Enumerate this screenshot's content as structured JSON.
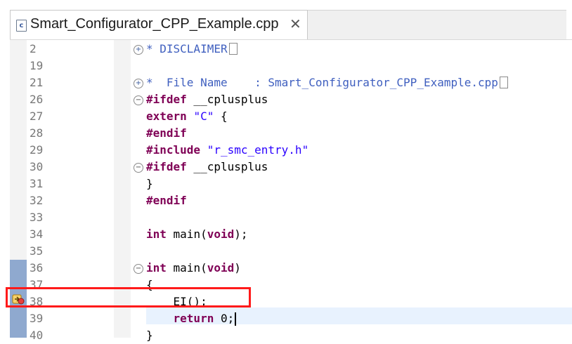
{
  "editor_tab": {
    "title": "Smart_Configurator_CPP_Example.cpp",
    "icon": "cpp-file-icon",
    "close_icon": "close-icon"
  },
  "colors": {
    "keyword": "#7f0055",
    "string": "#2a00ff",
    "comment": "#3f5fbf",
    "current_line": "#e8f2fe",
    "annotation_box": "#ff1a1a"
  },
  "code_lines": [
    {
      "number": "2",
      "fold": "expand",
      "collapsed": true,
      "tokens": [
        {
          "t": "* DISCLAIMER",
          "c": "cmt"
        }
      ]
    },
    {
      "number": "19",
      "fold": "",
      "collapsed": false,
      "tokens": []
    },
    {
      "number": "21",
      "fold": "expand",
      "collapsed": true,
      "tokens": [
        {
          "t": "*  File Name    : Smart_Configurator_CPP_Example.cpp",
          "c": "cmt"
        }
      ]
    },
    {
      "number": "26",
      "fold": "collapse",
      "collapsed": false,
      "tokens": [
        {
          "t": "#ifdef",
          "c": "kw"
        },
        {
          "t": " __cplusplus",
          "c": "plain"
        }
      ]
    },
    {
      "number": "27",
      "fold": "",
      "collapsed": false,
      "tokens": [
        {
          "t": "extern",
          "c": "kw"
        },
        {
          "t": " ",
          "c": "plain"
        },
        {
          "t": "\"C\"",
          "c": "str"
        },
        {
          "t": " {",
          "c": "plain"
        }
      ]
    },
    {
      "number": "28",
      "fold": "",
      "collapsed": false,
      "tokens": [
        {
          "t": "#endif",
          "c": "kw"
        }
      ]
    },
    {
      "number": "29",
      "fold": "",
      "collapsed": false,
      "tokens": [
        {
          "t": "#include",
          "c": "kw"
        },
        {
          "t": " ",
          "c": "plain"
        },
        {
          "t": "\"r_smc_entry.h\"",
          "c": "str"
        }
      ]
    },
    {
      "number": "30",
      "fold": "collapse",
      "collapsed": false,
      "tokens": [
        {
          "t": "#ifdef",
          "c": "kw"
        },
        {
          "t": " __cplusplus",
          "c": "plain"
        }
      ]
    },
    {
      "number": "31",
      "fold": "",
      "collapsed": false,
      "tokens": [
        {
          "t": "}",
          "c": "plain"
        }
      ]
    },
    {
      "number": "32",
      "fold": "",
      "collapsed": false,
      "tokens": [
        {
          "t": "#endif",
          "c": "kw"
        }
      ]
    },
    {
      "number": "33",
      "fold": "",
      "collapsed": false,
      "tokens": []
    },
    {
      "number": "34",
      "fold": "",
      "collapsed": false,
      "tokens": [
        {
          "t": "int",
          "c": "kw"
        },
        {
          "t": " main(",
          "c": "plain"
        },
        {
          "t": "void",
          "c": "kw"
        },
        {
          "t": ");",
          "c": "plain"
        }
      ]
    },
    {
      "number": "35",
      "fold": "",
      "collapsed": false,
      "tokens": []
    },
    {
      "number": "36",
      "fold": "collapse",
      "collapsed": false,
      "tokens": [
        {
          "t": "int",
          "c": "kw"
        },
        {
          "t": " main(",
          "c": "plain"
        },
        {
          "t": "void",
          "c": "kw"
        },
        {
          "t": ")",
          "c": "plain"
        }
      ]
    },
    {
      "number": "37",
      "fold": "",
      "collapsed": false,
      "tokens": [
        {
          "t": "{",
          "c": "plain"
        }
      ]
    },
    {
      "number": "38",
      "fold": "",
      "collapsed": false,
      "tokens": [
        {
          "t": "    EI();",
          "c": "plain"
        }
      ]
    },
    {
      "number": "39",
      "fold": "",
      "collapsed": false,
      "tokens": [
        {
          "t": "    ",
          "c": "plain"
        },
        {
          "t": "return",
          "c": "kw"
        },
        {
          "t": " 0;",
          "c": "plain"
        }
      ]
    },
    {
      "number": "40",
      "fold": "",
      "collapsed": false,
      "tokens": [
        {
          "t": "}",
          "c": "plain"
        }
      ]
    }
  ],
  "current_line_number": "39",
  "debug_marker_line": "38",
  "debug_marker_icon": "debug-current-instruction-icon",
  "annotation": "red-highlight-box"
}
